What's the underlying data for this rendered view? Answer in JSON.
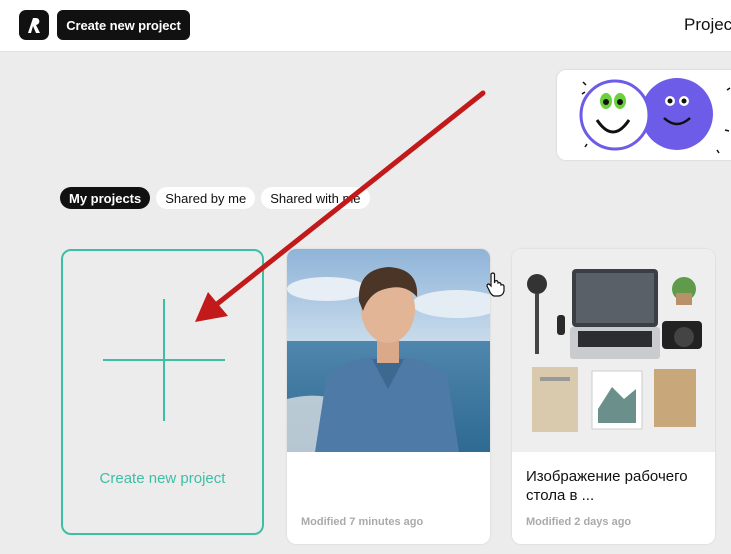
{
  "header": {
    "create_button": "Create new project",
    "page_title": "Projects"
  },
  "tabs": [
    {
      "label": "My projects",
      "active": true
    },
    {
      "label": "Shared by me",
      "active": false
    },
    {
      "label": "Shared with me",
      "active": false
    }
  ],
  "create_card": {
    "label": "Create new project"
  },
  "projects": [
    {
      "title": "",
      "modified": "Modified 7 minutes ago",
      "thumbnail": "photo of man in blue shirt by the sea"
    },
    {
      "title": "Изображение рабочего стола в ...",
      "modified": "Modified 2 days ago",
      "thumbnail": "flat lay desk with laptop, camera, microphone, notebooks"
    }
  ],
  "colors": {
    "accent": "#3dbfa6",
    "annotation_arrow": "#c21a1a",
    "primary_button": "#111111",
    "background": "#ececec"
  }
}
